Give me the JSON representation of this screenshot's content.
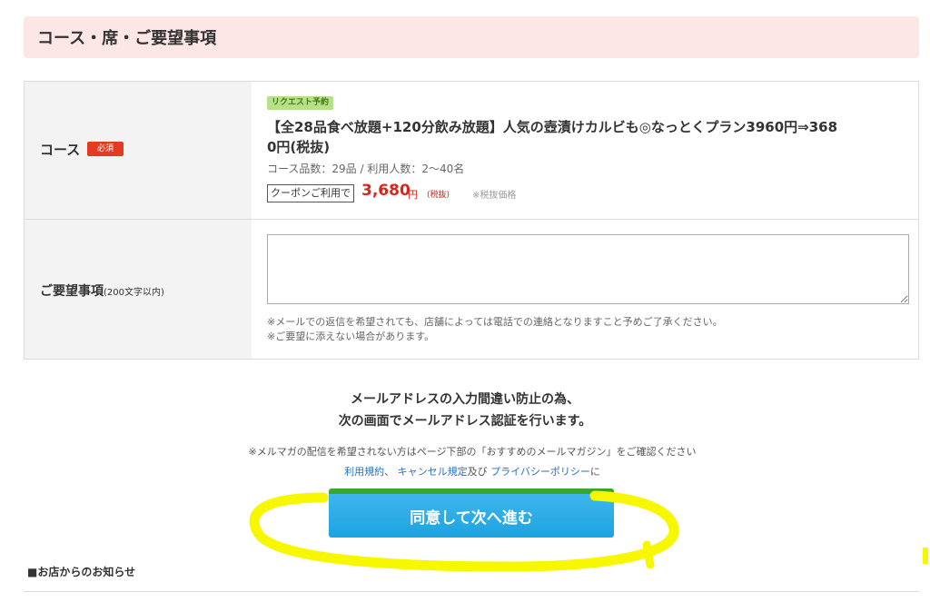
{
  "section": {
    "title": "コース・席・ご要望事項"
  },
  "course_row": {
    "label": "コース",
    "required_badge": "必須",
    "request_badge": "リクエスト予約",
    "course_title_line1": "【全28品食べ放題+120分飲み放題】人気の壺漬けカルビも◎なっとくプラン3960円⇒368",
    "course_title_line2": "0円(税抜)",
    "meta": "コース品数：29品 / 利用人数：2～40名",
    "coupon_label": "クーポンご利用で",
    "price": "3,680",
    "price_unit": "円",
    "price_tax": "(税抜)",
    "tax_note": "※税抜価格"
  },
  "request_row": {
    "label": "ご要望事項",
    "label_suffix": "(200文字以内)",
    "textarea_value": "",
    "note1": "※メールでの返信を希望されても、店舗によっては電話での連絡となりますこと予めご了承ください。",
    "note2": "※ご要望に添えない場合があります。"
  },
  "verify": {
    "line1": "メールアドレスの入力間違い防止の為、",
    "line2": "次の画面でメールアドレス認証を行います。"
  },
  "mailmag_note": "※メルマガの配信を希望されない方はページ下部の「おすすめのメールマガジン」をご確認ください",
  "links": {
    "terms": "利用規約",
    "sep1": "、",
    "cancel": "キャンセル規定",
    "and": "及び",
    "privacy": "プライバシーポリシー",
    "tail": "に"
  },
  "agree_button": "同意して次へ進む",
  "notice_heading": "■お店からのお知らせ",
  "colors": {
    "header_bg": "#fde6e6",
    "button": "#1ca3e0",
    "price": "#d9251d",
    "highlight": "#f7f700"
  }
}
